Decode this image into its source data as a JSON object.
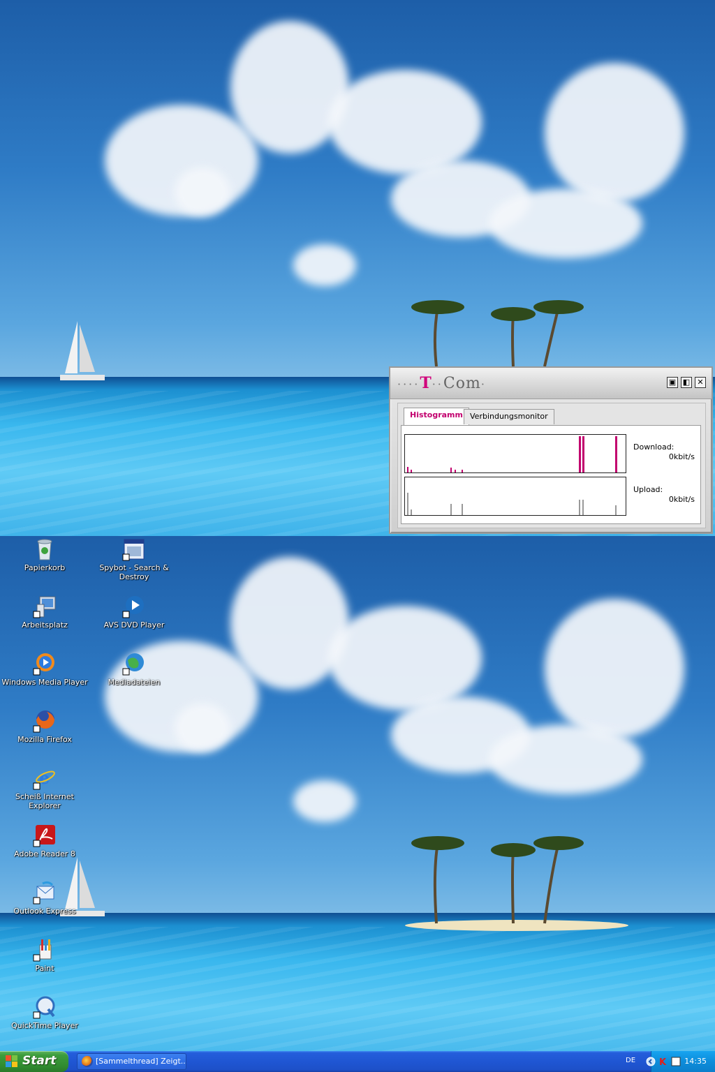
{
  "widget": {
    "title": "T-Com",
    "tabs": [
      {
        "label": "Histogramm",
        "active": true
      },
      {
        "label": "Verbindungsmonitor",
        "active": false
      }
    ],
    "download_label": "Download:",
    "download_value": "0kbit/s",
    "upload_label": "Upload:",
    "upload_value": "0kbit/s",
    "accent_color": "#d0007a",
    "controls": [
      "monitor-icon",
      "restore-icon",
      "close-icon"
    ]
  },
  "desktop_icons": [
    {
      "label": "Papierkorb",
      "icon": "recycle-bin-icon"
    },
    {
      "label": "Spybot - Search & Destroy",
      "icon": "spybot-icon"
    },
    {
      "label": "Arbeitsplatz",
      "icon": "my-computer-icon"
    },
    {
      "label": "AVS DVD Player",
      "icon": "avs-dvd-player-icon"
    },
    {
      "label": "Windows Media Player",
      "icon": "windows-media-player-icon"
    },
    {
      "label": "Mediadateien",
      "icon": "media-files-icon"
    },
    {
      "label": "Mozilla Firefox",
      "icon": "firefox-icon"
    },
    {
      "label": "Scheiß Internet Explorer",
      "icon": "internet-explorer-icon"
    },
    {
      "label": "Adobe Reader 8",
      "icon": "adobe-reader-icon"
    },
    {
      "label": "Outlook Express",
      "icon": "outlook-express-icon"
    },
    {
      "label": "Paint",
      "icon": "paint-icon"
    },
    {
      "label": "QuickTime Player",
      "icon": "quicktime-icon"
    }
  ],
  "taskbar": {
    "start_label": "Start",
    "task_label": "[Sammelthread] Zeigt...",
    "language": "DE",
    "clock": "14:35"
  }
}
